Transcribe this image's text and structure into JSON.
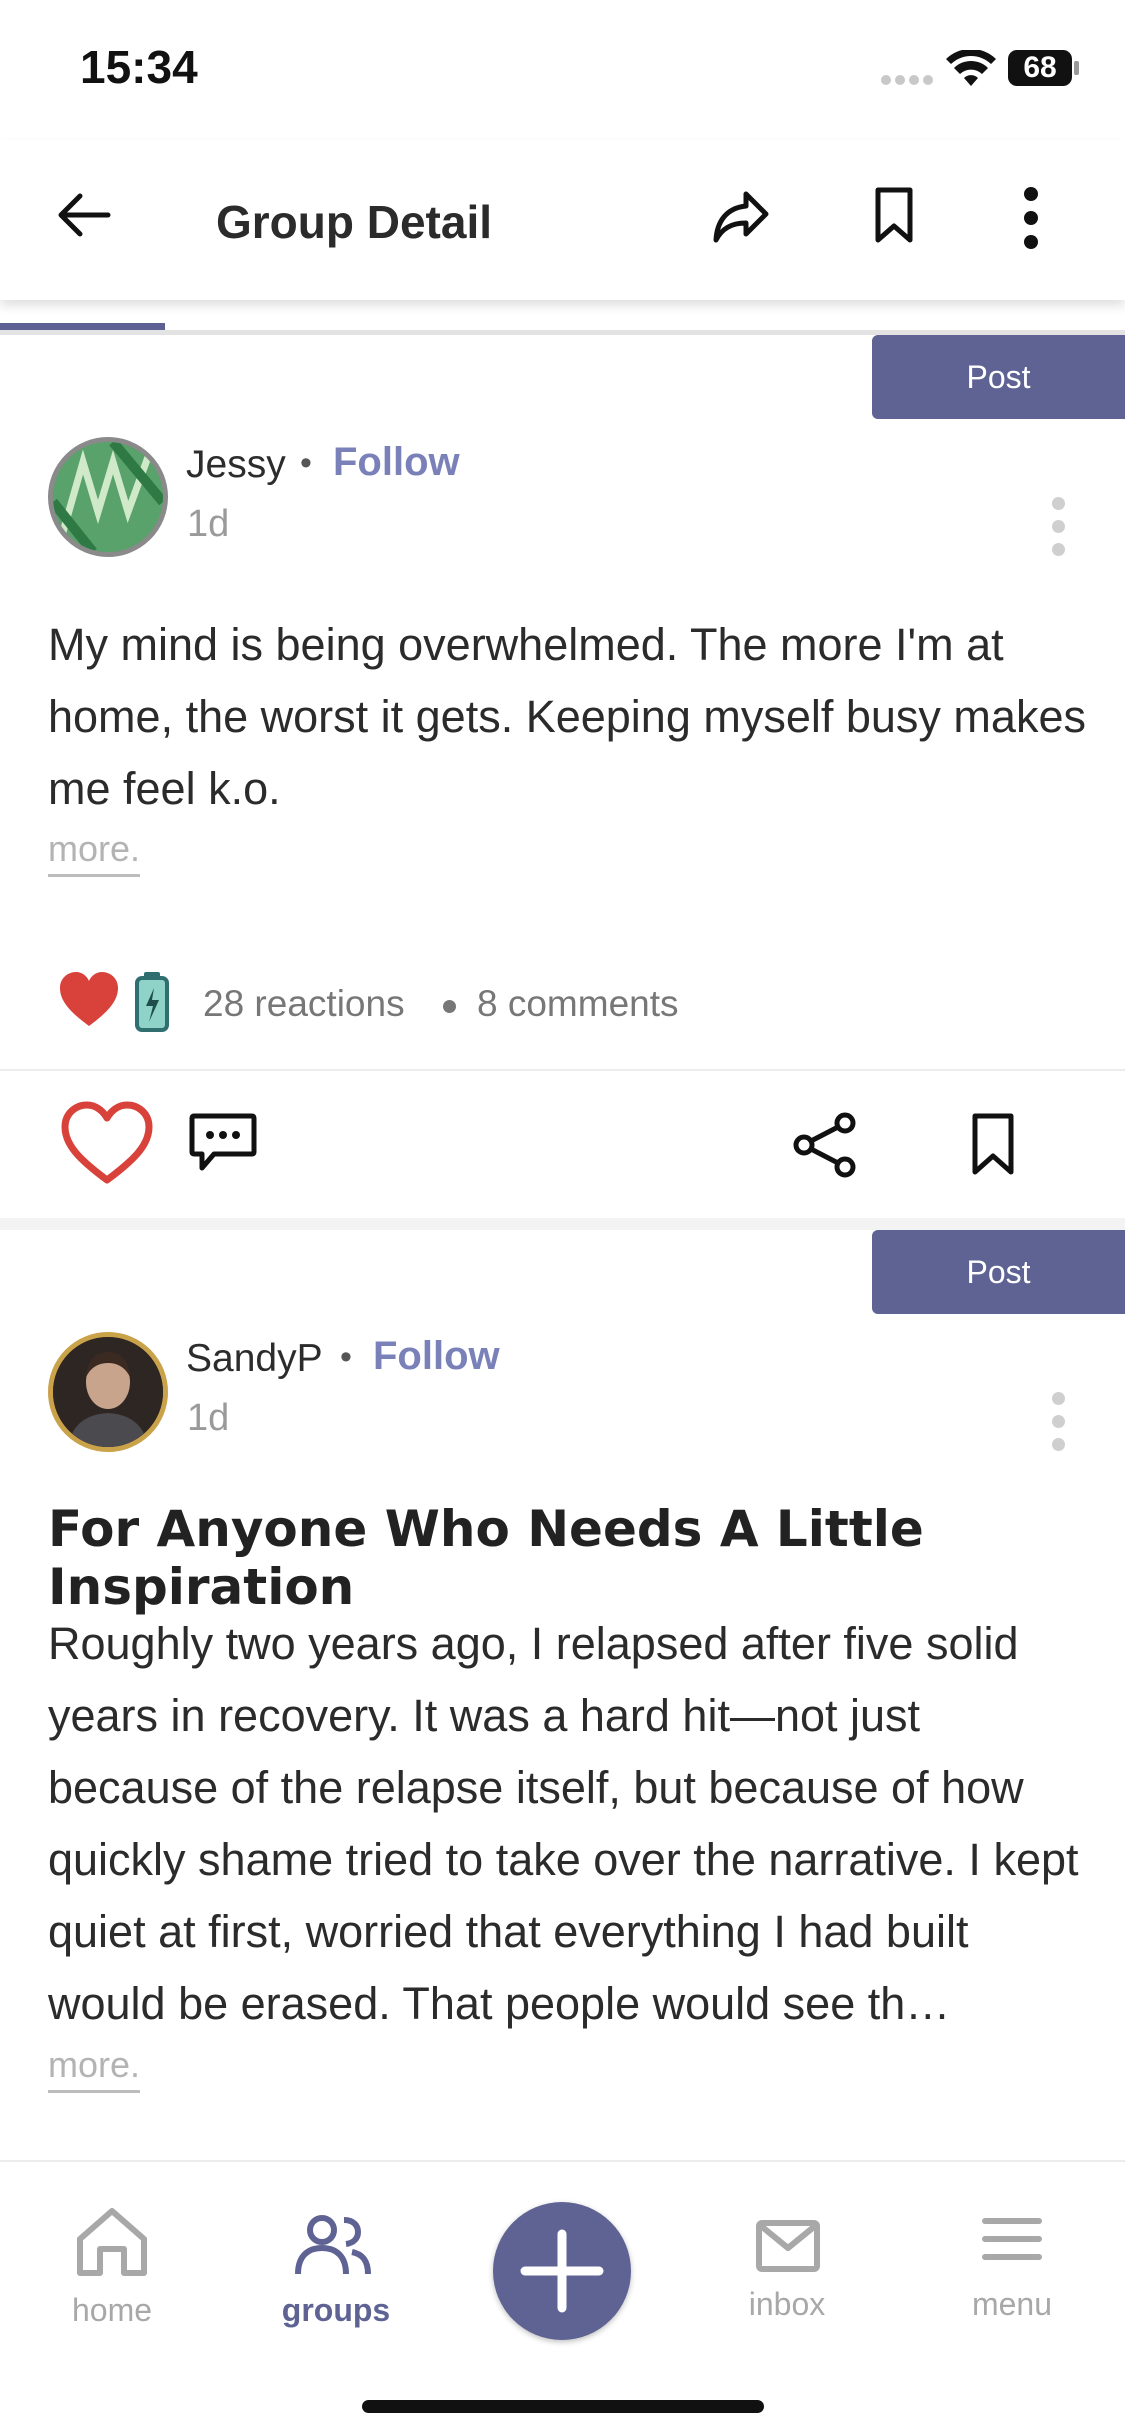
{
  "status_bar": {
    "time": "15:34",
    "battery": "68"
  },
  "header": {
    "title": "Group Detail"
  },
  "posts": [
    {
      "post_label": "Post",
      "author": "Jessy",
      "follow_label": "Follow",
      "age": "1d",
      "body": "My mind is being overwhelmed. The more I'm at home, the worst it gets. Keeping myself busy makes me feel k.o.",
      "more_label": "more.",
      "reactions": "28 reactions",
      "comments": "8 comments"
    },
    {
      "post_label": "Post",
      "author": "SandyP",
      "follow_label": "Follow",
      "age": "1d",
      "title": "For Anyone Who Needs A Little Inspiration",
      "body": "Roughly two years ago, I relapsed after five solid years in recovery. It was a hard hit—not just because of the relapse itself, but because of how quickly shame tried to take over the narrative. I kept quiet at first, worried that everything I had built would be erased. That people would see th…",
      "more_label": "more."
    }
  ],
  "bottom_nav": {
    "home": "home",
    "groups": "groups",
    "inbox": "inbox",
    "menu": "menu"
  },
  "colors": {
    "accent": "#5e6393",
    "follow": "#7a80b8",
    "heart": "#d9413b"
  }
}
